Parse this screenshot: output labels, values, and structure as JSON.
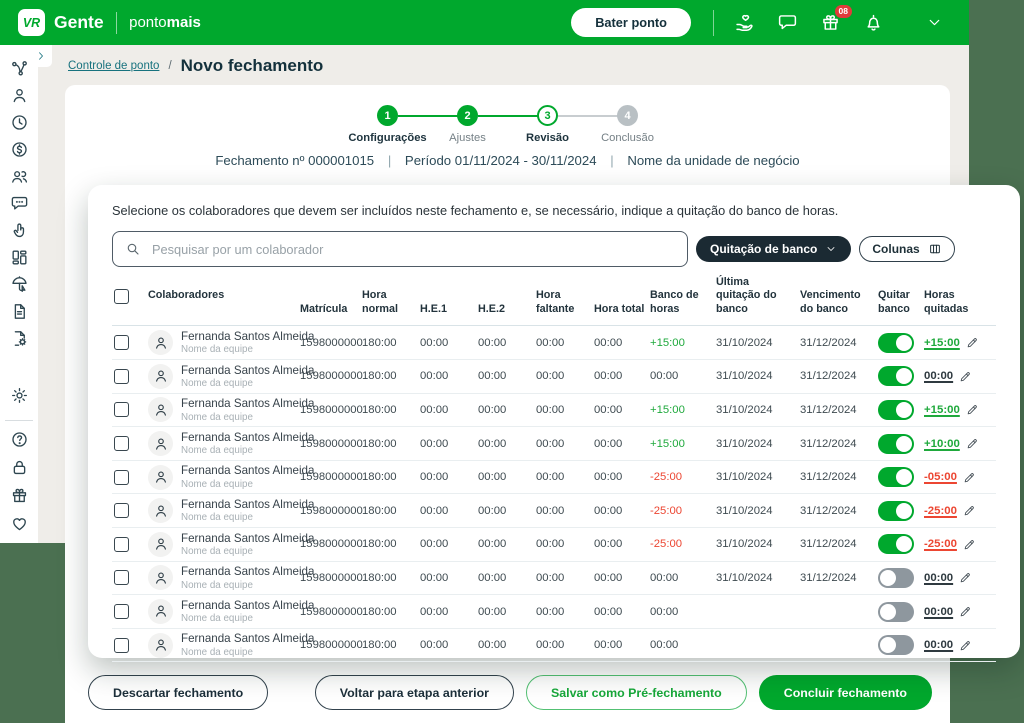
{
  "colors": {
    "brand_green": "#00A82D",
    "backdrop": "#4B7051",
    "positive": "#1FA93C",
    "negative": "#EC4632"
  },
  "header": {
    "logo_monogram": "VR",
    "brand": "Gente",
    "product_light": "ponto",
    "product_bold": "mais",
    "punch_button_label": "Bater ponto",
    "gift_badge": "08",
    "icons": [
      "hand-heart-icon",
      "chat-icon",
      "gift-icon",
      "bell-icon"
    ],
    "profile_chevron": "chevron-down-icon"
  },
  "sidebar": {
    "expand_icon": "chevron-right-icon",
    "top_icons": [
      "org-chart-icon",
      "user-icon",
      "clock-icon",
      "money-icon",
      "people-icon",
      "chat-dots-icon",
      "hand-tap-icon",
      "kanban-icon",
      "umbrella-icon",
      "document-icon",
      "document-gear-icon"
    ],
    "settings_icon": "gear-icon",
    "bottom_icons": [
      "help-icon",
      "lock-icon",
      "gift-icon",
      "heart-icon"
    ]
  },
  "breadcrumb": {
    "parent": "Controle de ponto",
    "separator": "/",
    "current": "Novo fechamento"
  },
  "stepper": [
    {
      "number": "1",
      "label": "Configurações",
      "state": "done",
      "label_strong": true
    },
    {
      "number": "2",
      "label": "Ajustes",
      "state": "done",
      "label_strong": false
    },
    {
      "number": "3",
      "label": "Revisão",
      "state": "current",
      "label_strong": true
    },
    {
      "number": "4",
      "label": "Conclusão",
      "state": "pending",
      "label_strong": false
    }
  ],
  "summary": {
    "closing": "Fechamento nº 000001015",
    "separator": "|",
    "period": "Período 01/11/2024 - 30/11/2024",
    "unit": "Nome da unidade de negócio"
  },
  "panel": {
    "instruction": "Selecione os colaboradores que devem ser incluídos neste fechamento e, se necessário, indique a quitação do banco de horas.",
    "search_icon": "search-icon",
    "search_placeholder": "Pesquisar por um colaborador",
    "bank_button_label": "Quitação de banco",
    "bank_button_chevron": "chevron-down-icon",
    "columns_button_label": "Colunas",
    "columns_button_icon": "columns-icon",
    "edit_icon": "pencil-icon",
    "avatar_icon": "user-icon"
  },
  "table": {
    "headers": [
      "Colaboradores",
      "Matrícula",
      "Hora normal",
      "H.E.1",
      "H.E.2",
      "Hora faltante",
      "Hora total",
      "Banco de horas",
      "Última quitação do banco",
      "Vencimento do banco",
      "Quitar banco",
      "Horas quitadas"
    ],
    "rows": [
      {
        "name": "Fernanda Santos Almeida",
        "team": "Nome da equipe",
        "matricula": "1598000000",
        "hora_normal": "180:00",
        "he1": "00:00",
        "he2": "00:00",
        "hora_faltante": "00:00",
        "hora_total": "00:00",
        "banco": "+15:00",
        "banco_tone": "positive",
        "ultima_quitacao": "31/10/2024",
        "vencimento": "31/12/2024",
        "quitar": true,
        "horas_quitadas": "+15:00",
        "quitadas_tone": "positive"
      },
      {
        "name": "Fernanda Santos Almeida",
        "team": "Nome da equipe",
        "matricula": "1598000000",
        "hora_normal": "180:00",
        "he1": "00:00",
        "he2": "00:00",
        "hora_faltante": "00:00",
        "hora_total": "00:00",
        "banco": "00:00",
        "banco_tone": "neutral",
        "ultima_quitacao": "31/10/2024",
        "vencimento": "31/12/2024",
        "quitar": true,
        "horas_quitadas": "00:00",
        "quitadas_tone": "neutral"
      },
      {
        "name": "Fernanda Santos Almeida",
        "team": "Nome da equipe",
        "matricula": "1598000000",
        "hora_normal": "180:00",
        "he1": "00:00",
        "he2": "00:00",
        "hora_faltante": "00:00",
        "hora_total": "00:00",
        "banco": "+15:00",
        "banco_tone": "positive",
        "ultima_quitacao": "31/10/2024",
        "vencimento": "31/12/2024",
        "quitar": true,
        "horas_quitadas": "+15:00",
        "quitadas_tone": "positive"
      },
      {
        "name": "Fernanda Santos Almeida",
        "team": "Nome da equipe",
        "matricula": "1598000000",
        "hora_normal": "180:00",
        "he1": "00:00",
        "he2": "00:00",
        "hora_faltante": "00:00",
        "hora_total": "00:00",
        "banco": "+15:00",
        "banco_tone": "positive",
        "ultima_quitacao": "31/10/2024",
        "vencimento": "31/12/2024",
        "quitar": true,
        "horas_quitadas": "+10:00",
        "quitadas_tone": "positive"
      },
      {
        "name": "Fernanda Santos Almeida",
        "team": "Nome da equipe",
        "matricula": "1598000000",
        "hora_normal": "180:00",
        "he1": "00:00",
        "he2": "00:00",
        "hora_faltante": "00:00",
        "hora_total": "00:00",
        "banco": "-25:00",
        "banco_tone": "negative",
        "ultima_quitacao": "31/10/2024",
        "vencimento": "31/12/2024",
        "quitar": true,
        "horas_quitadas": "-05:00",
        "quitadas_tone": "negative"
      },
      {
        "name": "Fernanda Santos Almeida",
        "team": "Nome da equipe",
        "matricula": "1598000000",
        "hora_normal": "180:00",
        "he1": "00:00",
        "he2": "00:00",
        "hora_faltante": "00:00",
        "hora_total": "00:00",
        "banco": "-25:00",
        "banco_tone": "negative",
        "ultima_quitacao": "31/10/2024",
        "vencimento": "31/12/2024",
        "quitar": true,
        "horas_quitadas": "-25:00",
        "quitadas_tone": "negative"
      },
      {
        "name": "Fernanda Santos Almeida",
        "team": "Nome da equipe",
        "matricula": "1598000000",
        "hora_normal": "180:00",
        "he1": "00:00",
        "he2": "00:00",
        "hora_faltante": "00:00",
        "hora_total": "00:00",
        "banco": "-25:00",
        "banco_tone": "negative",
        "ultima_quitacao": "31/10/2024",
        "vencimento": "31/12/2024",
        "quitar": true,
        "horas_quitadas": "-25:00",
        "quitadas_tone": "negative"
      },
      {
        "name": "Fernanda Santos Almeida",
        "team": "Nome da equipe",
        "matricula": "1598000000",
        "hora_normal": "180:00",
        "he1": "00:00",
        "he2": "00:00",
        "hora_faltante": "00:00",
        "hora_total": "00:00",
        "banco": "00:00",
        "banco_tone": "neutral",
        "ultima_quitacao": "31/10/2024",
        "vencimento": "31/12/2024",
        "quitar": false,
        "horas_quitadas": "00:00",
        "quitadas_tone": "neutral"
      },
      {
        "name": "Fernanda Santos Almeida",
        "team": "Nome da equipe",
        "matricula": "1598000000",
        "hora_normal": "180:00",
        "he1": "00:00",
        "he2": "00:00",
        "hora_faltante": "00:00",
        "hora_total": "00:00",
        "banco": "00:00",
        "banco_tone": "neutral",
        "ultima_quitacao": "",
        "vencimento": "",
        "quitar": false,
        "horas_quitadas": "00:00",
        "quitadas_tone": "neutral"
      },
      {
        "name": "Fernanda Santos Almeida",
        "team": "Nome da equipe",
        "matricula": "1598000000",
        "hora_normal": "180:00",
        "he1": "00:00",
        "he2": "00:00",
        "hora_faltante": "00:00",
        "hora_total": "00:00",
        "banco": "00:00",
        "banco_tone": "neutral",
        "ultima_quitacao": "",
        "vencimento": "",
        "quitar": false,
        "horas_quitadas": "00:00",
        "quitadas_tone": "neutral"
      }
    ]
  },
  "footer": {
    "discard": "Descartar fechamento",
    "back": "Voltar para etapa anterior",
    "save_pre": "Salvar como Pré-fechamento",
    "finish": "Concluir fechamento"
  }
}
